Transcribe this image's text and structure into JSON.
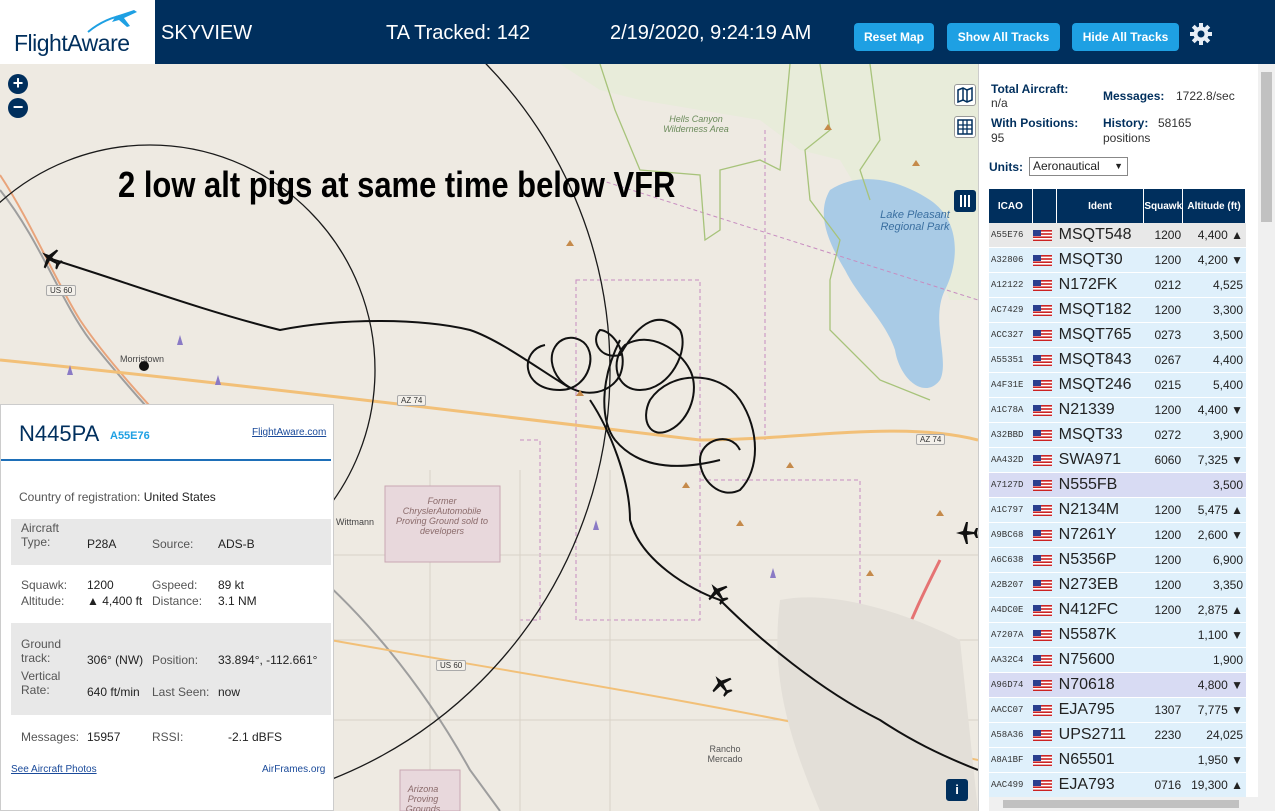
{
  "header": {
    "logo": "FlightAware",
    "app_name": "SKYVIEW",
    "tracked": "TA Tracked: 142",
    "datetime": "2/19/2020, 9:24:19 AM",
    "buttons": {
      "reset_map": "Reset Map",
      "show_all": "Show All Tracks",
      "hide_all": "Hide All Tracks"
    },
    "settings_icon": "gear-icon"
  },
  "map": {
    "annotation": "2 low alt pigs at same time below VFR",
    "labels": {
      "hells_canyon": "Hells Canyon Wilderness Area",
      "lake_pleasant": "Lake Pleasant Regional Park",
      "former_proving": "Former ChryslerAutomobile Proving Ground sold to developers",
      "morristown": "Morristown",
      "wittmann": "Wittmann",
      "rancho_mercado": "Rancho Mercado",
      "arizona_proving": "Arizona Proving Grounds"
    },
    "roads": {
      "us60_top": "US 60",
      "az74_left": "AZ 74",
      "az74_right": "AZ 74",
      "us60_bottom": "US 60"
    },
    "zoom_in": "+",
    "zoom_out": "−",
    "info_button": "i"
  },
  "aircraft_info": {
    "ident": "N445PA",
    "icao": "A55E76",
    "flightaware_link": "FlightAware.com",
    "country_label": "Country of registration:",
    "country": "United States",
    "aircraft_type_label": "Aircraft Type:",
    "aircraft_type": "P28A",
    "source_label": "Source:",
    "source": "ADS-B",
    "squawk_label": "Squawk:",
    "squawk": "1200",
    "altitude_label": "Altitude:",
    "altitude": "▲ 4,400 ft",
    "gspeed_label": "Gspeed:",
    "gspeed": "89 kt",
    "distance_label": "Distance:",
    "distance": "3.1 NM",
    "ground_track_label": "Ground track:",
    "ground_track": "306° (NW)",
    "position_label": "Position:",
    "position": "33.894°, -112.661°",
    "vertical_rate_label": "Vertical Rate:",
    "vertical_rate": "640 ft/min",
    "last_seen_label": "Last Seen:",
    "last_seen": "now",
    "messages_label": "Messages:",
    "messages": "15957",
    "rssi_label": "RSSI:",
    "rssi": "-2.1 dBFS",
    "see_photos": "See Aircraft Photos",
    "airframes": "AirFrames.org"
  },
  "sidebar": {
    "total_aircraft_label": "Total Aircraft:",
    "total_aircraft": "n/a",
    "messages_label": "Messages:",
    "messages": "1722.8/sec",
    "with_positions_label": "With Positions:",
    "with_positions": "95",
    "history_label": "History:",
    "history": "58165 positions",
    "units_label": "Units:",
    "units_value": "Aeronautical",
    "columns": {
      "icao": "ICAO",
      "ident": "Ident",
      "squawk": "Squawk",
      "altitude": "Altitude (ft)"
    },
    "rows": [
      {
        "icao": "A55E76",
        "ident": "MSQT548",
        "squawk": "1200",
        "alt": "4,400 ▲"
      },
      {
        "icao": "A32806",
        "ident": "MSQT30",
        "squawk": "1200",
        "alt": "4,200 ▼"
      },
      {
        "icao": "A12122",
        "ident": "N172FK",
        "squawk": "0212",
        "alt": "4,525"
      },
      {
        "icao": "AC7429",
        "ident": "MSQT182",
        "squawk": "1200",
        "alt": "3,300"
      },
      {
        "icao": "ACC327",
        "ident": "MSQT765",
        "squawk": "0273",
        "alt": "3,500"
      },
      {
        "icao": "A55351",
        "ident": "MSQT843",
        "squawk": "0267",
        "alt": "4,400"
      },
      {
        "icao": "A4F31E",
        "ident": "MSQT246",
        "squawk": "0215",
        "alt": "5,400"
      },
      {
        "icao": "A1C78A",
        "ident": "N21339",
        "squawk": "1200",
        "alt": "4,400 ▼"
      },
      {
        "icao": "A32BBD",
        "ident": "MSQT33",
        "squawk": "0272",
        "alt": "3,900"
      },
      {
        "icao": "AA432D",
        "ident": "SWA971",
        "squawk": "6060",
        "alt": "7,325 ▼"
      },
      {
        "icao": "A7127D",
        "ident": "N555FB",
        "squawk": "",
        "alt": "3,500"
      },
      {
        "icao": "A1C797",
        "ident": "N2134M",
        "squawk": "1200",
        "alt": "5,475 ▲"
      },
      {
        "icao": "A9BC68",
        "ident": "N7261Y",
        "squawk": "1200",
        "alt": "2,600 ▼"
      },
      {
        "icao": "A6C638",
        "ident": "N5356P",
        "squawk": "1200",
        "alt": "6,900"
      },
      {
        "icao": "A2B207",
        "ident": "N273EB",
        "squawk": "1200",
        "alt": "3,350"
      },
      {
        "icao": "A4DC0E",
        "ident": "N412FC",
        "squawk": "1200",
        "alt": "2,875 ▲"
      },
      {
        "icao": "A7207A",
        "ident": "N5587K",
        "squawk": "",
        "alt": "1,100 ▼"
      },
      {
        "icao": "AA32C4",
        "ident": "N75600",
        "squawk": "",
        "alt": "1,900"
      },
      {
        "icao": "A96D74",
        "ident": "N70618",
        "squawk": "",
        "alt": "4,800 ▼"
      },
      {
        "icao": "AACC07",
        "ident": "EJA795",
        "squawk": "1307",
        "alt": "7,775 ▼"
      },
      {
        "icao": "A58A36",
        "ident": "UPS2711",
        "squawk": "2230",
        "alt": "24,025"
      },
      {
        "icao": "A8A1BF",
        "ident": "N65501",
        "squawk": "",
        "alt": "1,950 ▼"
      },
      {
        "icao": "AAC499",
        "ident": "EJA793",
        "squawk": "0716",
        "alt": "19,300 ▲"
      }
    ]
  }
}
